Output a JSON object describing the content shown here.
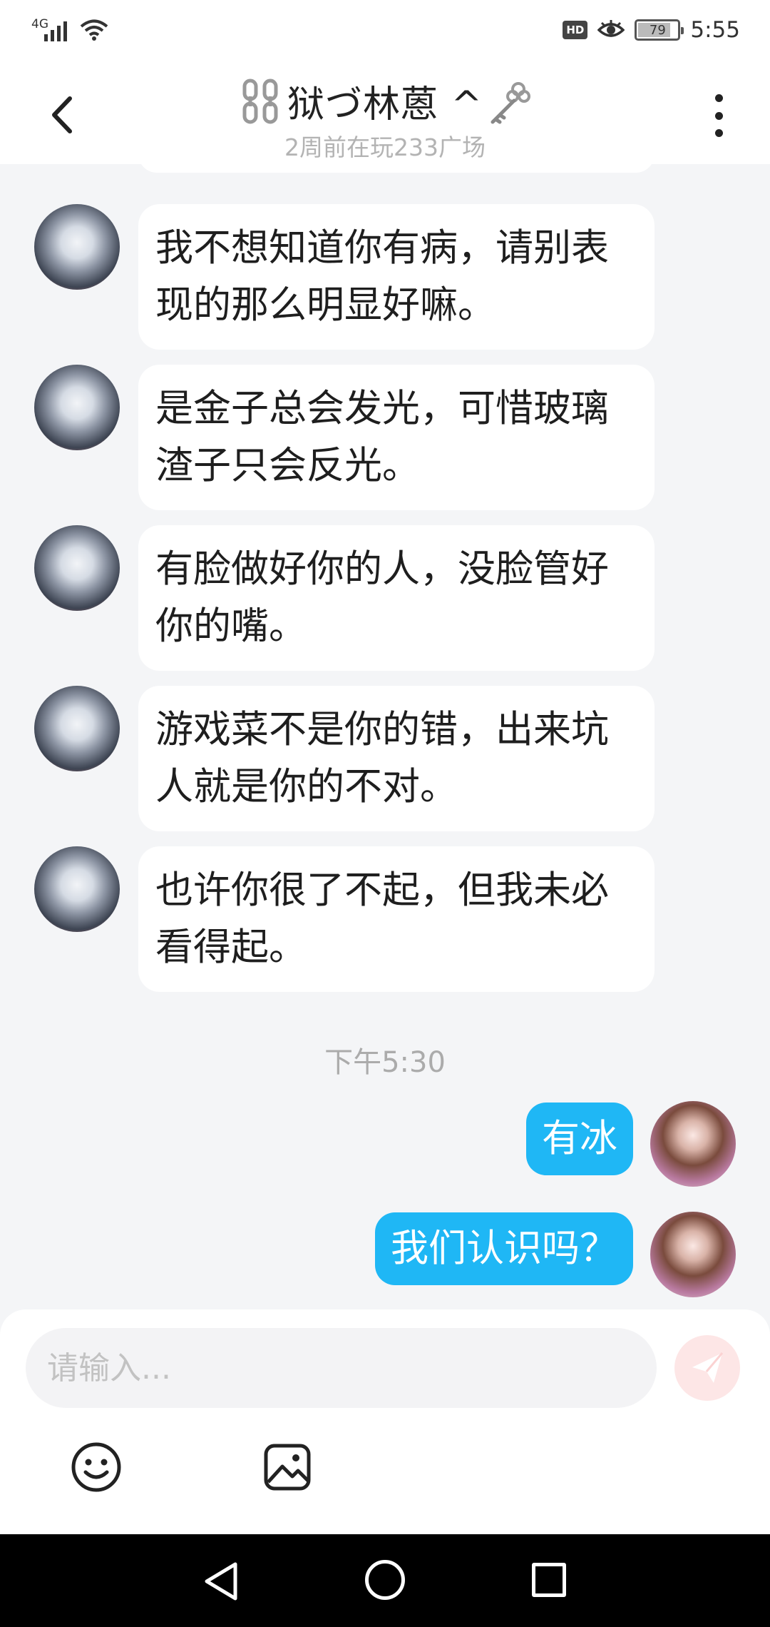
{
  "status_bar": {
    "network": "4G",
    "hd": "HD",
    "battery": "79",
    "battery_level_pct": 79,
    "time": "5:55"
  },
  "header": {
    "title": "狱づ林蒽 ^",
    "subtitle": "2周前在玩233广场"
  },
  "messages": [
    {
      "side": "left",
      "text": "我不想知道你有病，请别表现的那么明显好嘛。"
    },
    {
      "side": "left",
      "text": "是金子总会发光，可惜玻璃渣子只会反光。"
    },
    {
      "side": "left",
      "text": "有脸做好你的人，没脸管好你的嘴。"
    },
    {
      "side": "left",
      "text": "游戏菜不是你的错，出来坑人就是你的不对。"
    },
    {
      "side": "left",
      "text": "也许你很了不起，但我未必看得起。"
    },
    {
      "side": "right",
      "text": "有冰"
    },
    {
      "side": "right",
      "text": "我们认识吗？"
    }
  ],
  "timestamp": "下午5:30",
  "composer": {
    "placeholder": "请输入..."
  },
  "colors": {
    "accent": "#1fb7f5",
    "background": "#f4f5f7",
    "send_disabled": "#fde6e6"
  },
  "icons": [
    "back-arrow-icon",
    "more-icon",
    "chain-icon",
    "key-icon",
    "send-icon",
    "emoji-icon",
    "image-icon"
  ]
}
